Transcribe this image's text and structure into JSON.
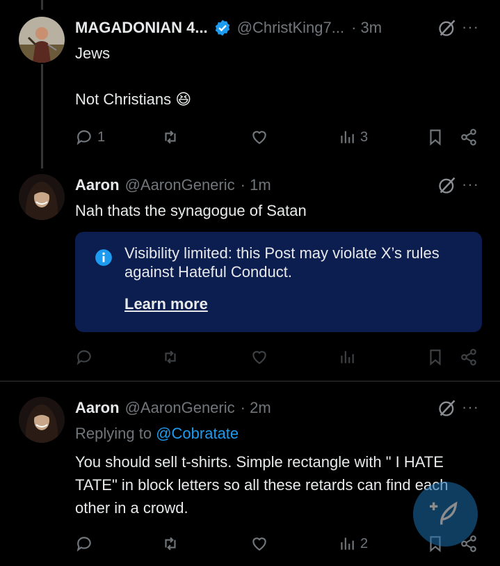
{
  "posts": [
    {
      "author_name": "MAGADONIAN 4...",
      "handle": "@ChristKing7...",
      "time": "· 3m",
      "verified": true,
      "text_lines": [
        "Jews",
        "",
        "Not Christians 😆"
      ],
      "actions": {
        "replies": "1",
        "reposts": "",
        "likes": "",
        "views": "3"
      }
    },
    {
      "author_name": "Aaron",
      "handle": "@AaronGeneric",
      "time": "· 1m",
      "text": "Nah thats the synagogue of Satan",
      "notice": {
        "message": "Visibility limited: this Post may violate X’s rules against Hateful Conduct.",
        "link": "Learn more"
      }
    },
    {
      "author_name": "Aaron",
      "handle": "@AaronGeneric",
      "time": "· 2m",
      "replying_label": "Replying to",
      "replying_handle": "@Cobratate",
      "text": "You should sell t-shirts. Simple rectangle with \" I HATE TATE\" in block letters so all these retards can find each other in a crowd.",
      "actions": {
        "views": "2"
      }
    }
  ],
  "more_icon": "···",
  "colors": {
    "background": "#000000",
    "accent": "#1d9bf0",
    "notice_bg": "#0c1e4f",
    "muted": "#71767b"
  },
  "icons": [
    "verified-badge-icon",
    "grok-icon",
    "more-icon",
    "reply-icon",
    "repost-icon",
    "like-icon",
    "views-icon",
    "bookmark-icon",
    "share-icon",
    "info-icon",
    "compose-icon"
  ]
}
